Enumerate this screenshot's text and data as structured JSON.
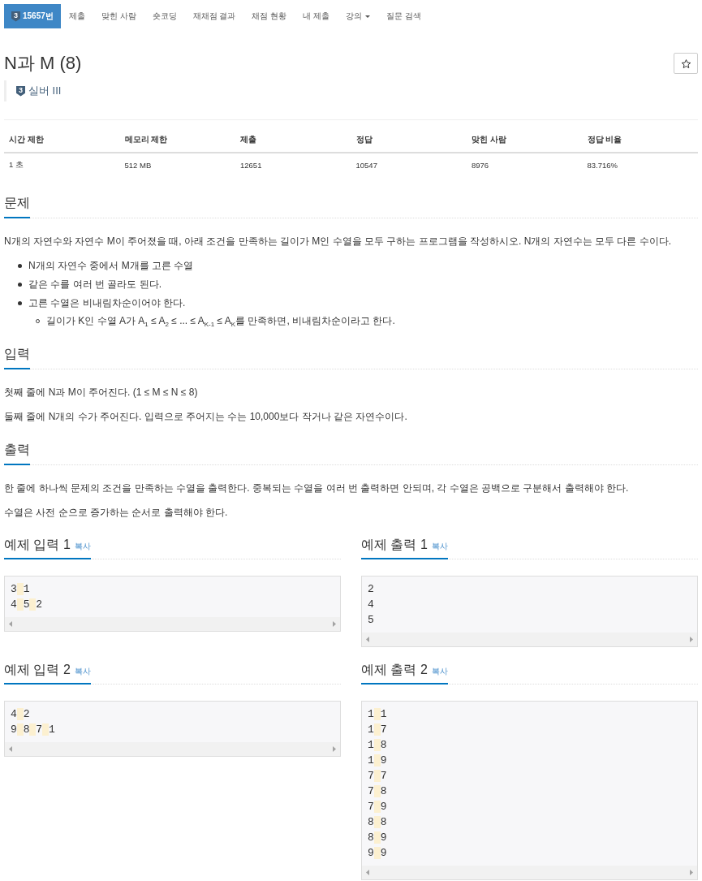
{
  "nav": {
    "items": [
      {
        "label": "15657번",
        "badge": "3",
        "selected": true,
        "dropdown": false
      },
      {
        "label": "제출",
        "selected": false,
        "dropdown": false
      },
      {
        "label": "맞힌 사람",
        "selected": false,
        "dropdown": false
      },
      {
        "label": "숏코딩",
        "selected": false,
        "dropdown": false
      },
      {
        "label": "재채점 결과",
        "selected": false,
        "dropdown": false
      },
      {
        "label": "채점 현황",
        "selected": false,
        "dropdown": false
      },
      {
        "label": "내 제출",
        "selected": false,
        "dropdown": false
      },
      {
        "label": "강의",
        "selected": false,
        "dropdown": true
      },
      {
        "label": "질문 검색",
        "selected": false,
        "dropdown": false
      }
    ]
  },
  "problem": {
    "title": "N과 M (8)",
    "starred": false,
    "tier": {
      "badge": "3",
      "label": "실버 III"
    }
  },
  "stats": {
    "columns": [
      "시간 제한",
      "메모리 제한",
      "제출",
      "정답",
      "맞힌 사람",
      "정답 비율"
    ],
    "rows": [
      [
        "1 초",
        "512 MB",
        "12651",
        "10547",
        "8976",
        "83.716%"
      ]
    ]
  },
  "sections": [
    {
      "title": "문제",
      "blocks": [
        {
          "kind": "paragraph",
          "text": "N개의 자연수와 자연수 M이 주어졌을 때, 아래 조건을 만족하는 길이가 M인 수열을 모두 구하는 프로그램을 작성하시오. N개의 자연수는 모두 다른 수이다."
        },
        {
          "kind": "list",
          "items": [
            {
              "text": "N개의 자연수 중에서 M개를 고른 수열"
            },
            {
              "text": "같은 수를 여러 번 골라도 된다."
            },
            {
              "text": "고른 수열은 비내림차순이어야 한다.",
              "children": [
                {
                  "text": "길이가 K인 수열 A가 A$_{1}$ ≤ A$_{2}$ ≤ ... ≤ A$_{K-1}$ ≤ A$_{K}$를 만족하면, 비내림차순이라고 한다."
                }
              ]
            }
          ]
        }
      ]
    },
    {
      "title": "입력",
      "blocks": [
        {
          "kind": "paragraph",
          "text": "첫째 줄에 N과 M이 주어진다. (1 ≤ M ≤ N ≤ 8)"
        },
        {
          "kind": "paragraph",
          "text": "둘째 줄에 N개의 수가 주어진다. 입력으로 주어지는 수는 10,000보다 작거나 같은 자연수이다."
        }
      ]
    },
    {
      "title": "출력",
      "blocks": [
        {
          "kind": "paragraph",
          "text": "한 줄에 하나씩 문제의 조건을 만족하는 수열을 출력한다. 중복되는 수열을 여러 번 출력하면 안되며, 각 수열은 공백으로 구분해서 출력해야 한다."
        },
        {
          "kind": "paragraph",
          "text": "수열은 사전 순으로 증가하는 순서로 출력해야 한다."
        }
      ]
    }
  ],
  "samples": [
    {
      "title": "예제 입력 1",
      "copy": "복사",
      "lines": [
        "3 1",
        "4 5 2"
      ]
    },
    {
      "title": "예제 출력 1",
      "copy": "복사",
      "lines": [
        "2",
        "4",
        "5"
      ]
    },
    {
      "title": "예제 입력 2",
      "copy": "복사",
      "lines": [
        "4 2",
        "9 8 7 1"
      ]
    },
    {
      "title": "예제 출력 2",
      "copy": "복사",
      "lines": [
        "1 1",
        "1 7",
        "1 8",
        "1 9",
        "7 7",
        "7 8",
        "7 9",
        "8 8",
        "8 9",
        "9 9"
      ]
    }
  ]
}
